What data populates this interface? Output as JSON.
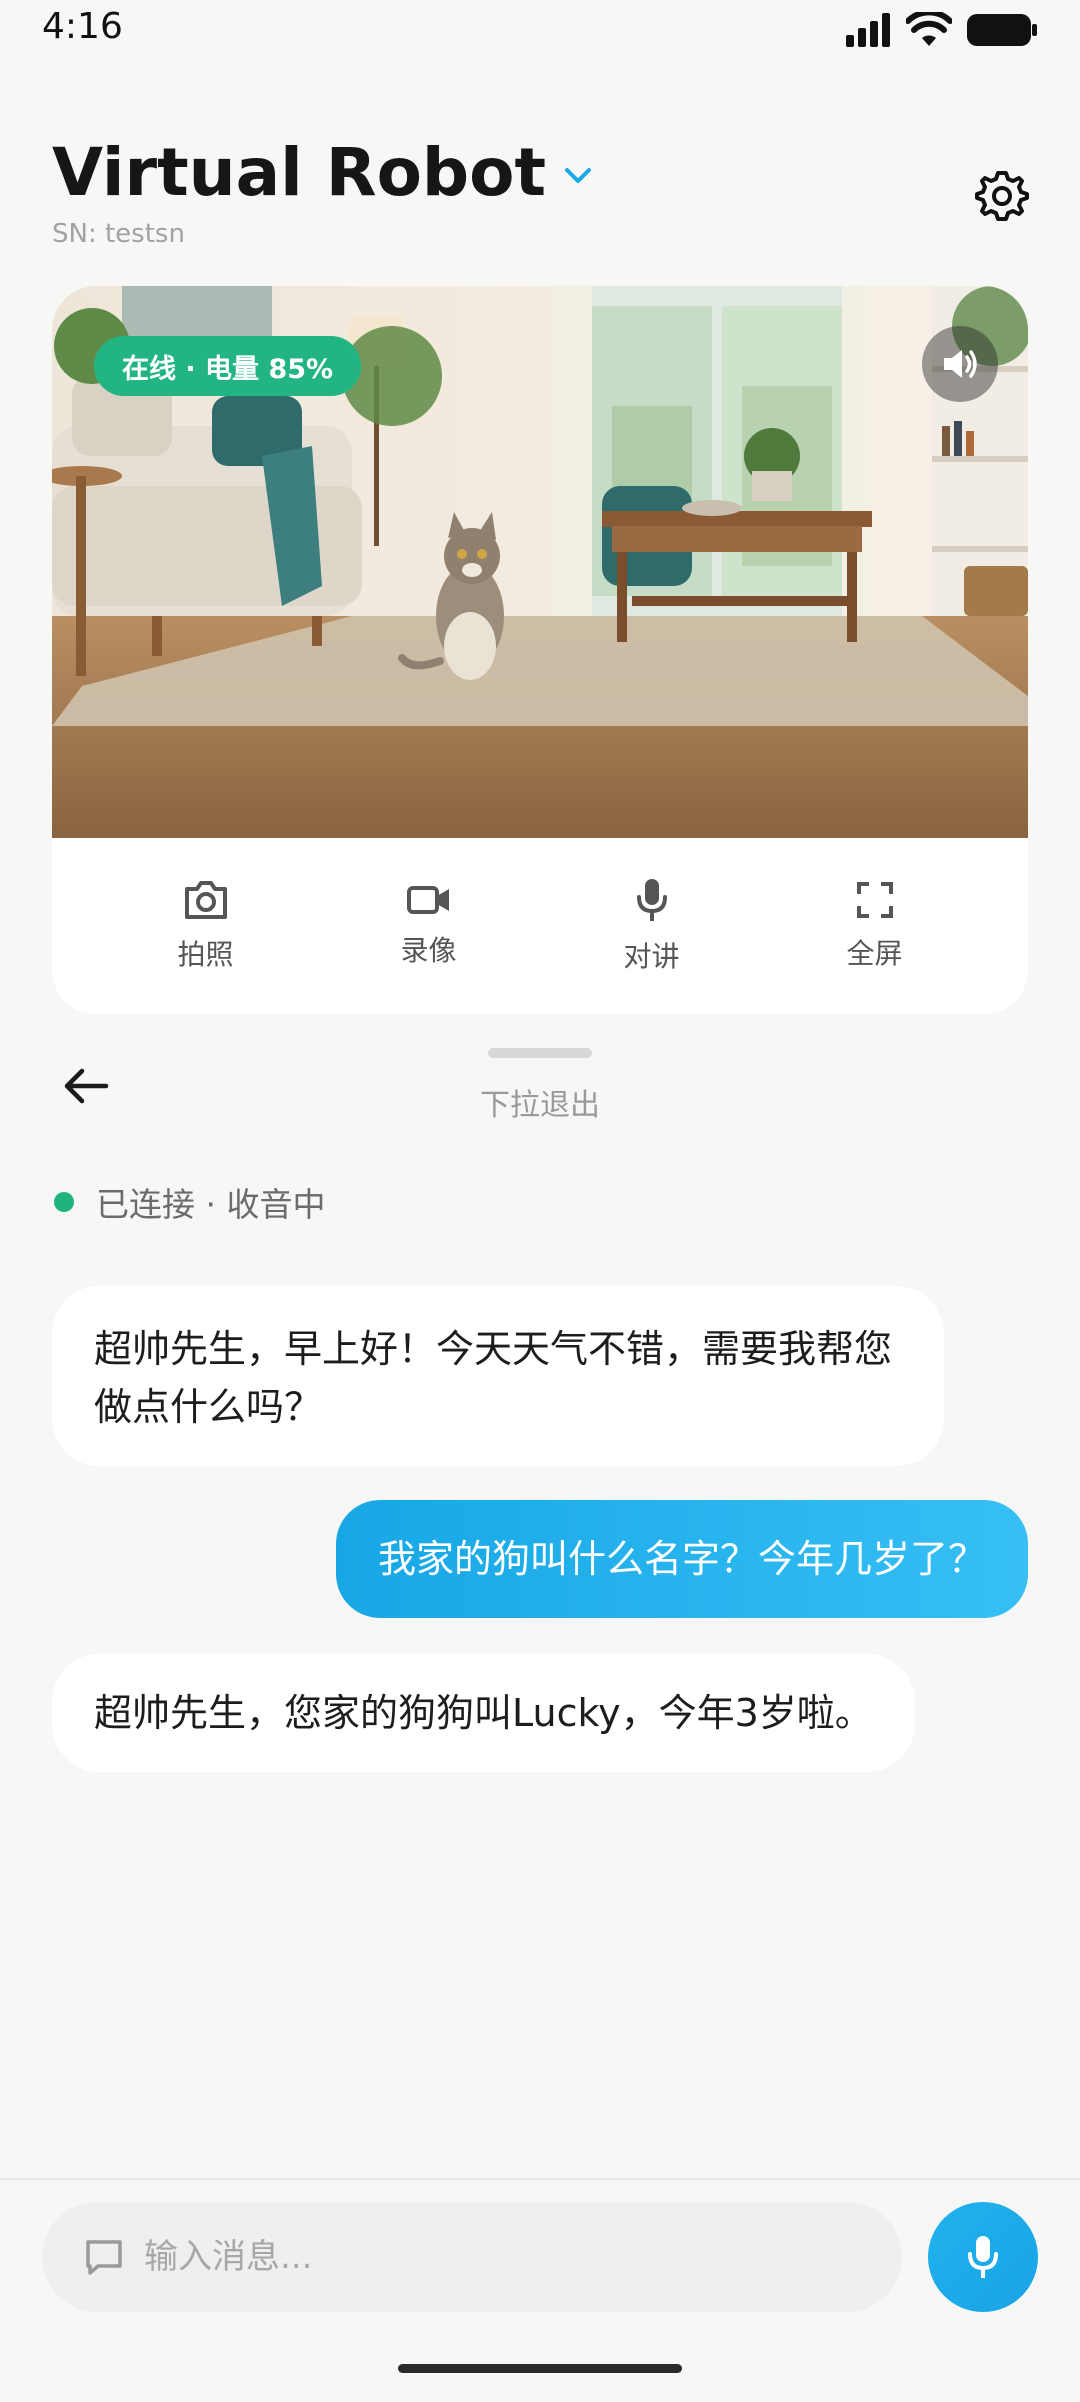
{
  "status_bar": {
    "time": "4:16"
  },
  "header": {
    "title": "Virtual Robot",
    "serial": "SN: testsn"
  },
  "video": {
    "status_text": "在线 · 电量 85%"
  },
  "actions": [
    {
      "label": "拍照",
      "icon": "camera-icon"
    },
    {
      "label": "录像",
      "icon": "video-camera-icon"
    },
    {
      "label": "对讲",
      "icon": "microphone-icon"
    },
    {
      "label": "全屏",
      "icon": "fullscreen-icon"
    }
  ],
  "panel": {
    "pull_hint": "下拉退出"
  },
  "connection": {
    "text": "已连接 · 收音中"
  },
  "messages": [
    {
      "role": "assistant",
      "text": "超帅先生，早上好！今天天气不错，需要我帮您做点什么吗？"
    },
    {
      "role": "user",
      "text": "我家的狗叫什么名字？今年几岁了？"
    },
    {
      "role": "assistant",
      "text": "超帅先生，您家的狗狗叫Lucky，今年3岁啦。"
    }
  ],
  "input": {
    "placeholder": "输入消息..."
  },
  "colors": {
    "accent": "#1aa9e8",
    "online": "#22b583",
    "background": "#f7f7f6"
  }
}
